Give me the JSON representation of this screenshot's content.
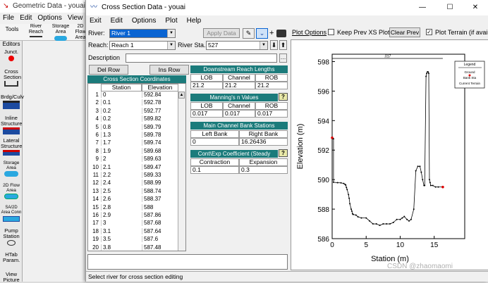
{
  "bg_window": {
    "title": "Geometric Data - youai",
    "menu": [
      "File",
      "Edit",
      "Options",
      "View"
    ],
    "tools": [
      "Tools",
      "River Reach",
      "Storage Area",
      "2D Flow Area"
    ],
    "editors_label": "Editors",
    "editors": [
      {
        "label": "Junct.",
        "icon": "junction-icon"
      },
      {
        "label": "Cross Section",
        "icon": "cross-section-icon"
      },
      {
        "label": "Brdg/Culv",
        "icon": "bridge-culvert-icon"
      },
      {
        "label": "Inline Structure",
        "icon": "inline-structure-icon"
      },
      {
        "label": "Lateral Structure",
        "icon": "lateral-structure-icon"
      },
      {
        "label": "Storage Area",
        "icon": "storage-area-icon"
      },
      {
        "label": "2D Flow Area",
        "icon": "2d-flow-area-icon"
      },
      {
        "label": "SA/2D Area Conn",
        "icon": "sa-2d-connection-icon"
      },
      {
        "label": "Pump Station",
        "icon": "pump-station-icon"
      },
      {
        "label": "HTab Param.",
        "icon": ""
      },
      {
        "label": "View Picture",
        "icon": ""
      }
    ]
  },
  "window": {
    "title": "Cross Section Data - youai",
    "menu": [
      "Exit",
      "Edit",
      "Options",
      "Plot",
      "Help"
    ],
    "controls": {
      "minimize": "—",
      "maximize": "☐",
      "close": "✕"
    }
  },
  "form": {
    "river_label": "River:",
    "river_value": "River 1",
    "apply_data": "Apply Data",
    "reach_label": "Reach:",
    "reach_value": "Reach 1",
    "river_sta_label": "River Sta.:",
    "river_sta_value": "527",
    "description_label": "Description",
    "description_value": "",
    "del_row": "Del Row",
    "ins_row": "Ins Row"
  },
  "plot_options": {
    "plot_options_link": "Plot Options",
    "keep_prev_label": "Keep Prev XS Plots",
    "keep_prev_checked": false,
    "clear_prev": "Clear Prev",
    "plot_terrain_label": "Plot Terrain (if availab",
    "plot_terrain_checked": true
  },
  "coords_table": {
    "title": "Cross Section Coordinates",
    "headers": [
      "Station",
      "Elevation"
    ],
    "rows": [
      [
        "1",
        "0",
        "592.84"
      ],
      [
        "2",
        "0.1",
        "592.78"
      ],
      [
        "3",
        "0.2",
        "592.77"
      ],
      [
        "4",
        "0.2",
        "589.82"
      ],
      [
        "5",
        "0.8",
        "589.79"
      ],
      [
        "6",
        "1.3",
        "589.78"
      ],
      [
        "7",
        "1.7",
        "589.74"
      ],
      [
        "8",
        "1.9",
        "589.68"
      ],
      [
        "9",
        "2",
        "589.63"
      ],
      [
        "10",
        "2.1",
        "589.47"
      ],
      [
        "11",
        "2.2",
        "589.33"
      ],
      [
        "12",
        "2.4",
        "588.99"
      ],
      [
        "13",
        "2.5",
        "588.74"
      ],
      [
        "14",
        "2.6",
        "588.37"
      ],
      [
        "15",
        "2.8",
        "588"
      ],
      [
        "16",
        "2.9",
        "587.86"
      ],
      [
        "17",
        "3",
        "587.68"
      ],
      [
        "18",
        "3.1",
        "587.64"
      ],
      [
        "19",
        "3.5",
        "587.6"
      ],
      [
        "20",
        "3.8",
        "587.48"
      ]
    ]
  },
  "downstream": {
    "title": "Downstream Reach Lengths",
    "headers": [
      "LOB",
      "Channel",
      "ROB"
    ],
    "values": [
      "21.2",
      "21.2",
      "21.2"
    ]
  },
  "mannings": {
    "title": "Manning's n Values",
    "help": "?",
    "headers": [
      "LOB",
      "Channel",
      "ROB"
    ],
    "values": [
      "0.017",
      "0.017",
      "0.017"
    ]
  },
  "bank_stations": {
    "title": "Main Channel Bank Stations",
    "headers": [
      "Left Bank",
      "Right Bank"
    ],
    "values": [
      "0",
      "16.26436"
    ]
  },
  "contraction": {
    "title": "Cont\\Exp Coefficient (Steady",
    "help": "?",
    "headers": [
      "Contraction",
      "Expansion"
    ],
    "values": [
      "0.1",
      "0.3"
    ]
  },
  "status": "Select river for cross section editing",
  "watermark": "CSDN @zhaomaomi",
  "chart_data": {
    "type": "line",
    "title": "",
    "top_label": ".017",
    "xlabel": "Station (m)",
    "ylabel": "Elevation (m)",
    "xlim": [
      0,
      17
    ],
    "ylim": [
      586,
      598.5
    ],
    "xticks": [
      0,
      5,
      10,
      15
    ],
    "yticks": [
      586,
      588,
      590,
      592,
      594,
      596,
      598
    ],
    "legend": {
      "title": "Legend",
      "items": [
        "Ground",
        "Bank Sta",
        "Current Terrain"
      ],
      "placement": "top-right"
    },
    "series": [
      {
        "name": "Ground",
        "color": "#000000",
        "x": [
          0,
          0.1,
          0.2,
          0.2,
          0.8,
          1.3,
          1.7,
          1.9,
          2,
          2.1,
          2.2,
          2.4,
          2.5,
          2.6,
          2.8,
          2.9,
          3,
          3.1,
          3.5,
          3.8,
          4.3,
          5,
          5.5,
          6,
          6.5,
          7,
          7.5,
          8,
          8.5,
          9,
          9.5,
          10,
          10.3,
          10.6,
          11,
          11.3,
          11.6,
          12,
          12.3,
          12.6,
          12.9,
          13.1,
          13.3,
          13.5,
          13.6,
          13.8,
          13.9,
          14,
          14.1,
          14.2,
          14.3,
          14.4,
          14.5,
          14.8,
          15.2,
          15.6,
          16.2
        ],
        "y": [
          592.84,
          592.78,
          592.77,
          589.82,
          589.79,
          589.78,
          589.74,
          589.68,
          589.63,
          589.47,
          589.33,
          588.99,
          588.74,
          588.37,
          588,
          587.86,
          587.68,
          587.64,
          587.6,
          587.48,
          587.4,
          587.4,
          587.2,
          587.0,
          587.0,
          586.9,
          587.0,
          587.0,
          587.0,
          587.1,
          587.3,
          587.3,
          587.4,
          587.5,
          587.3,
          587.2,
          587.3,
          588.0,
          590.6,
          590.9,
          590.9,
          590.5,
          590.0,
          589.6,
          589.6,
          597.0,
          597.2,
          597.3,
          597.3,
          597.2,
          590.0,
          589.8,
          589.6,
          589.6,
          589.5,
          589.5,
          589.5
        ]
      }
    ],
    "bank_stations": [
      0,
      16.26436
    ],
    "grid": false
  }
}
